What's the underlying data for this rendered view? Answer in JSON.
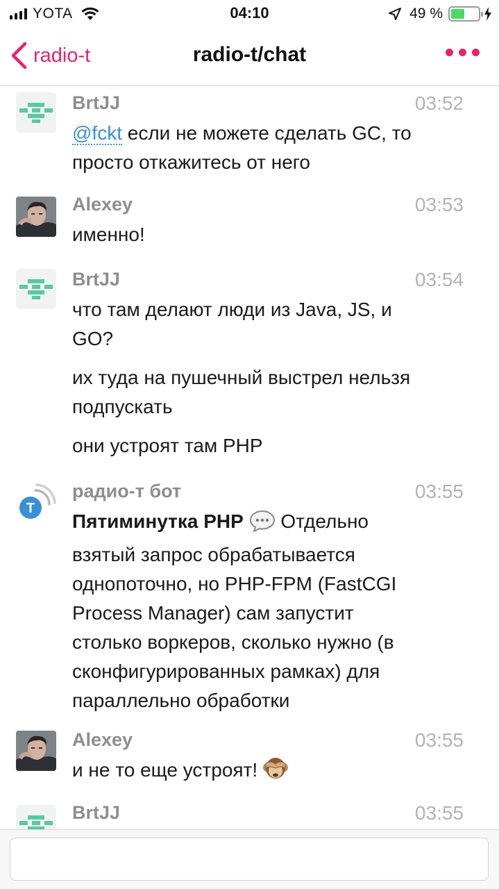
{
  "status_bar": {
    "carrier": "YOTA",
    "time": "04:10",
    "battery_percent": "49 %",
    "battery_level": 0.49,
    "icons": [
      "signal-icon",
      "wifi-icon",
      "location-arrow-icon",
      "battery-icon",
      "charging-bolt-icon"
    ]
  },
  "nav": {
    "back_label": "radio-t",
    "title": "radio-t/chat",
    "accent_color": "#e8236e",
    "more_icon": "more-dots-icon"
  },
  "messages": [
    {
      "author": "BrtJJ",
      "time": "03:52",
      "mention": "@fckt",
      "lines": [
        " если не можете сделать GC, то",
        "просто откажитесь от него"
      ]
    },
    {
      "author": "Alexey",
      "time": "03:53",
      "lines": [
        "именно!"
      ]
    },
    {
      "author": "BrtJJ",
      "time": "03:54",
      "lines": [
        "что там делают люди из Java, JS, и",
        "GO?"
      ],
      "followups": [
        [
          "их туда на пушечный выстрел нельзя",
          "подпускать"
        ],
        [
          "они устроят там PHP"
        ]
      ]
    },
    {
      "author": "радио-т бот",
      "time": "03:55",
      "bold_prefix": "Пятиминутка PHP",
      "emoji": "speech-bubble-icon",
      "first_line_rest": " Отдельно",
      "lines": [
        "взятый запрос обрабатывается",
        "однопоточно, но PHP-FPM (FastCGI",
        "Process Manager) сам запустит",
        "столько воркеров, сколько нужно (в",
        "сконфигурированных рамках) для",
        "параллельно обработки"
      ]
    },
    {
      "author": "Alexey",
      "time": "03:55",
      "lines": [
        "и не то еще устроят! "
      ],
      "emoji": "see-no-evil-monkey-icon"
    },
    {
      "author": "BrtJJ",
      "time": "03:55",
      "lines": []
    }
  ],
  "input": {
    "placeholder": "",
    "value": ""
  }
}
